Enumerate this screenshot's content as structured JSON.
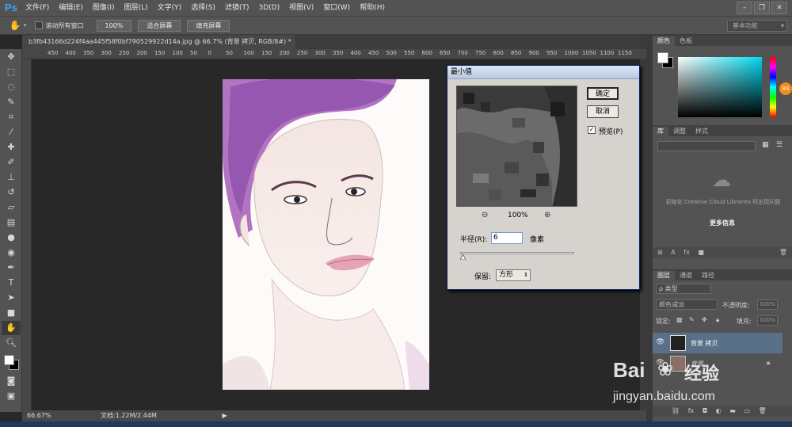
{
  "app": {
    "logo": "Ps"
  },
  "menu": [
    "文件(F)",
    "编辑(E)",
    "图像(I)",
    "图层(L)",
    "文字(Y)",
    "选择(S)",
    "滤镜(T)",
    "3D(D)",
    "视图(V)",
    "窗口(W)",
    "帮助(H)"
  ],
  "window_controls": [
    "–",
    "❐",
    "✕"
  ],
  "options": {
    "scroll_all_label": "滚动所有窗口",
    "zoom_100": "100%",
    "fit_screen": "适合屏幕",
    "fill_screen": "填充屏幕",
    "workspace": "基本功能"
  },
  "document": {
    "tab_title": "b3fb43166d224f4aa445f58f0bf790529922d14a.jpg @ 66.7% (背景 拷贝, RGB/8#) *",
    "close": "×"
  },
  "ruler_ticks": [
    "450",
    "400",
    "350",
    "300",
    "250",
    "200",
    "150",
    "100",
    "50",
    "0",
    "50",
    "100",
    "150",
    "200",
    "250",
    "300",
    "350",
    "400",
    "450",
    "500",
    "550",
    "600",
    "650",
    "700",
    "750",
    "800",
    "850",
    "900",
    "950",
    "1000",
    "1050",
    "1100",
    "1150"
  ],
  "status": {
    "zoom": "66.67%",
    "doc_size": "文档:1.22M/2.44M"
  },
  "dialog": {
    "title": "最小值",
    "ok": "确定",
    "cancel": "取消",
    "preview_label": "预览(P)",
    "preview_checked": true,
    "zoom_level": "100%",
    "radius_label": "半径(R):",
    "radius_value": "6",
    "radius_unit": "像素",
    "preserve_label": "保留:",
    "preserve_value": "方形"
  },
  "panels": {
    "color_tabs": [
      "颜色",
      "色板"
    ],
    "library_tabs": [
      "库",
      "调整",
      "样式"
    ],
    "library_message": "初始化 Creative Cloud Libraries 时出现问题",
    "library_more": "更多信息",
    "layers_tabs": [
      "图层",
      "通道",
      "路径"
    ],
    "layer_filter": "ρ 类型",
    "blend_mode": "颜色减淡",
    "opacity_label": "不透明度:",
    "opacity_value": "100%",
    "lock_label": "锁定:",
    "fill_label": "填充:",
    "fill_value": "100%",
    "layers": [
      {
        "name": "背景 拷贝",
        "selected": true
      },
      {
        "name": "背景",
        "selected": false
      }
    ],
    "hue_badge": "84"
  },
  "watermark": {
    "brand": "Bai",
    "brand_cn": "经验",
    "url": "jingyan.baidu.com"
  },
  "colors": {
    "accent": "#31a8ff",
    "selected_layer": "#5a6f88"
  }
}
